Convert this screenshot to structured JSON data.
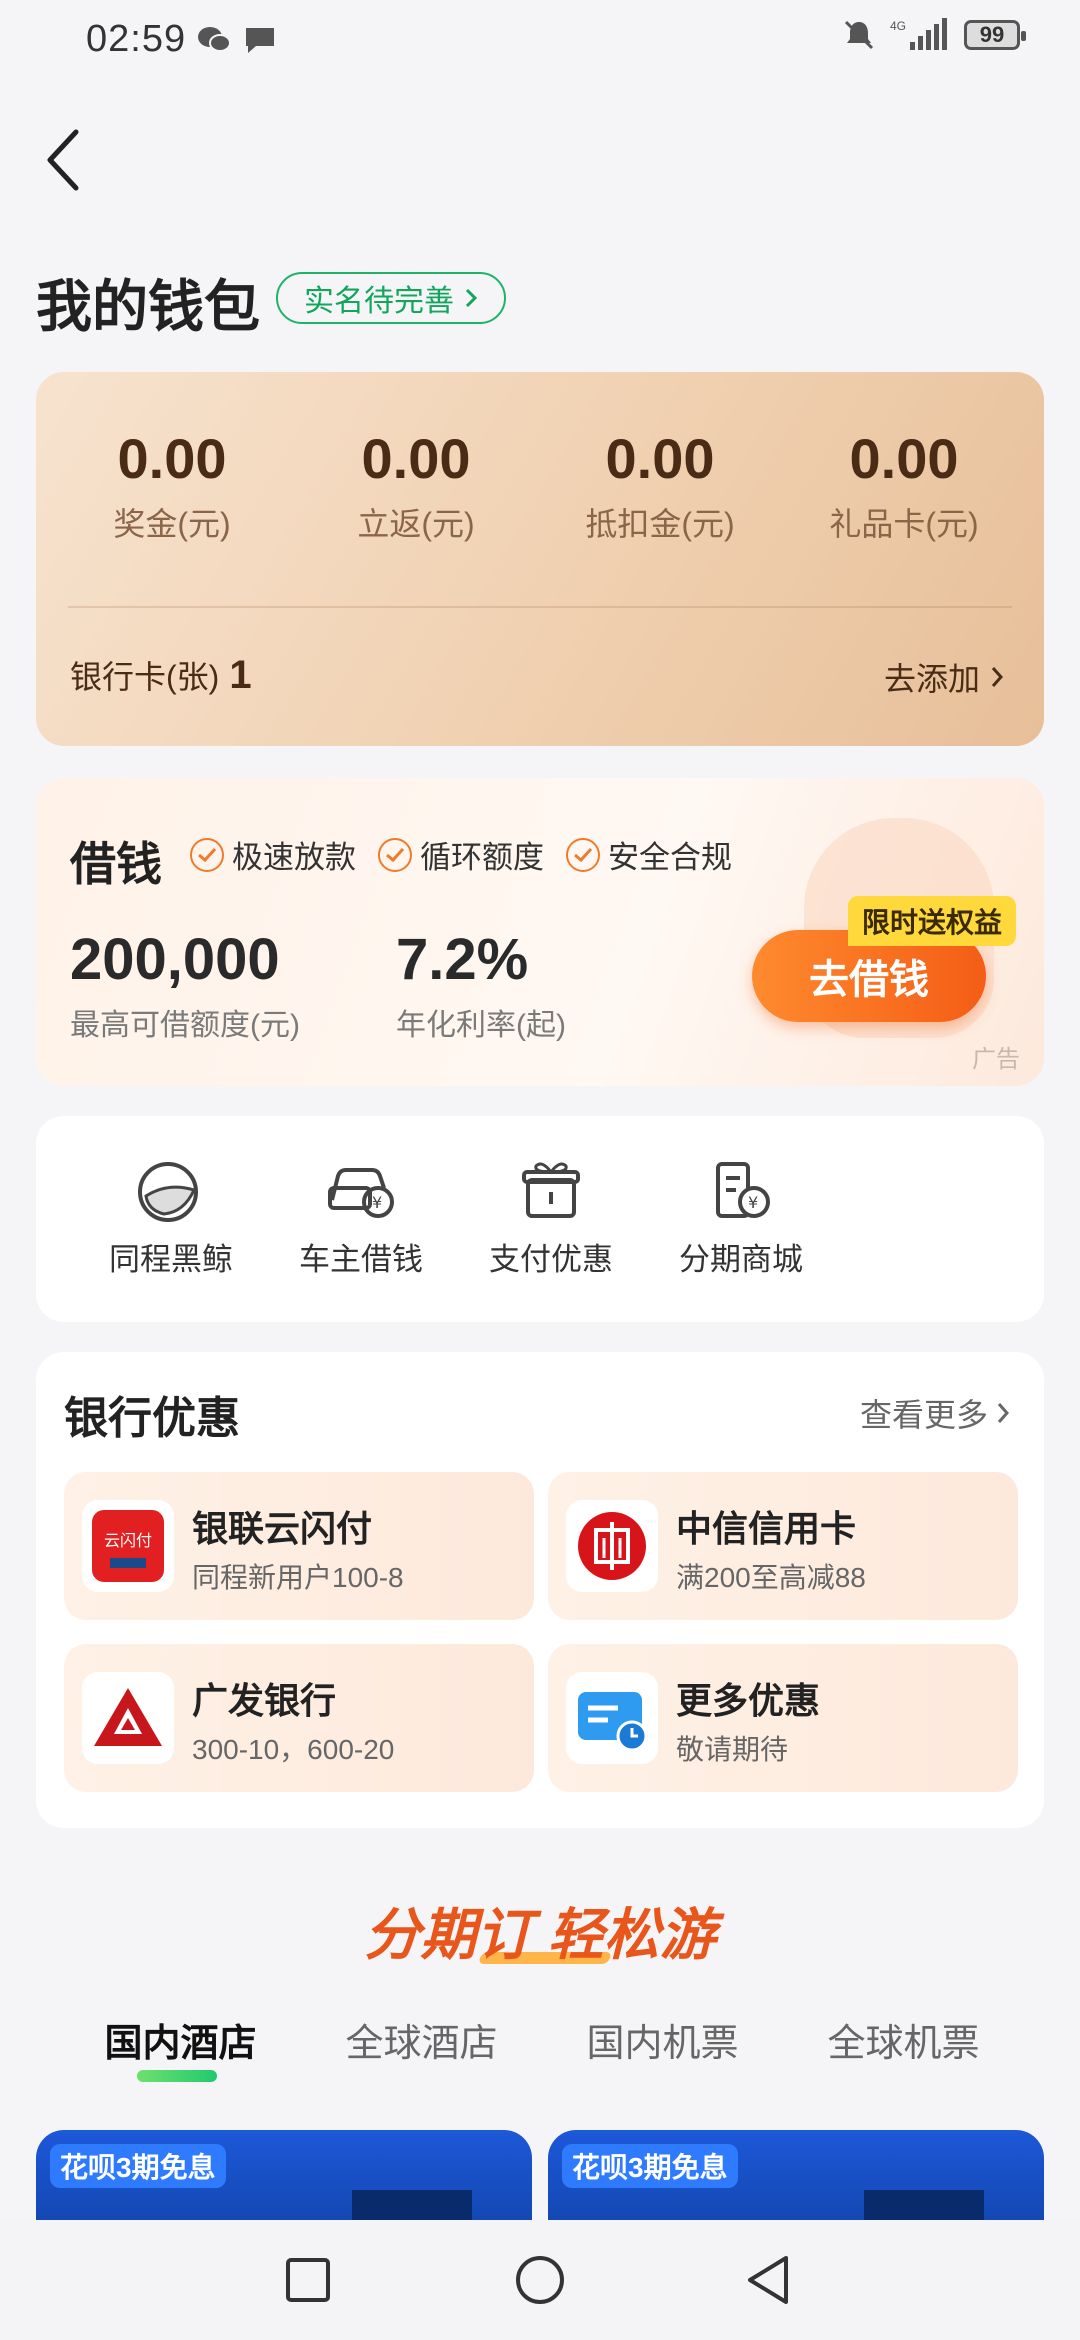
{
  "status": {
    "time": "02:59",
    "battery": "99",
    "network": "4G"
  },
  "header": {
    "title": "我的钱包",
    "verify_label": "实名待完善"
  },
  "balance": {
    "items": [
      {
        "value": "0.00",
        "label": "奖金(元)"
      },
      {
        "value": "0.00",
        "label": "立返(元)"
      },
      {
        "value": "0.00",
        "label": "抵扣金(元)"
      },
      {
        "value": "0.00",
        "label": "礼品卡(元)"
      }
    ],
    "bank_label": "银行卡(张)",
    "bank_count": "1",
    "add_label": "去添加"
  },
  "loan": {
    "title": "借钱",
    "tags": [
      "极速放款",
      "循环额度",
      "安全合规"
    ],
    "amount": "200,000",
    "amount_label": "最高可借额度(元)",
    "rate": "7.2%",
    "rate_label": "年化利率(起)",
    "button": "去借钱",
    "badge": "限时送权益",
    "ad": "广告"
  },
  "shortcuts": [
    {
      "label": "同程黑鲸",
      "icon": "whale-icon"
    },
    {
      "label": "车主借钱",
      "icon": "car-loan-icon"
    },
    {
      "label": "支付优惠",
      "icon": "gift-icon"
    },
    {
      "label": "分期商城",
      "icon": "installment-mall-icon"
    }
  ],
  "offers": {
    "title": "银行优惠",
    "more": "查看更多",
    "items": [
      {
        "name": "银联云闪付",
        "desc": "同程新用户100-8",
        "icon": "unionpay-icon",
        "logo_text": "云闪付"
      },
      {
        "name": "中信信用卡",
        "desc": "满200至高减88",
        "icon": "citic-icon"
      },
      {
        "name": "广发银行",
        "desc": "300-10，600-20",
        "icon": "cgb-icon"
      },
      {
        "name": "更多优惠",
        "desc": "敬请期待",
        "icon": "card-clock-icon"
      }
    ]
  },
  "promo": {
    "heading": "分期订 轻松游"
  },
  "tabs": [
    "国内酒店",
    "全球酒店",
    "国内机票",
    "全球机票"
  ],
  "hotels": [
    {
      "badge": "花呗3期免息"
    },
    {
      "badge": "花呗3期免息"
    }
  ],
  "colors": {
    "accent_green": "#1fb36a",
    "accent_orange": "#f45d16",
    "badge_yellow": "#ffd93b"
  }
}
